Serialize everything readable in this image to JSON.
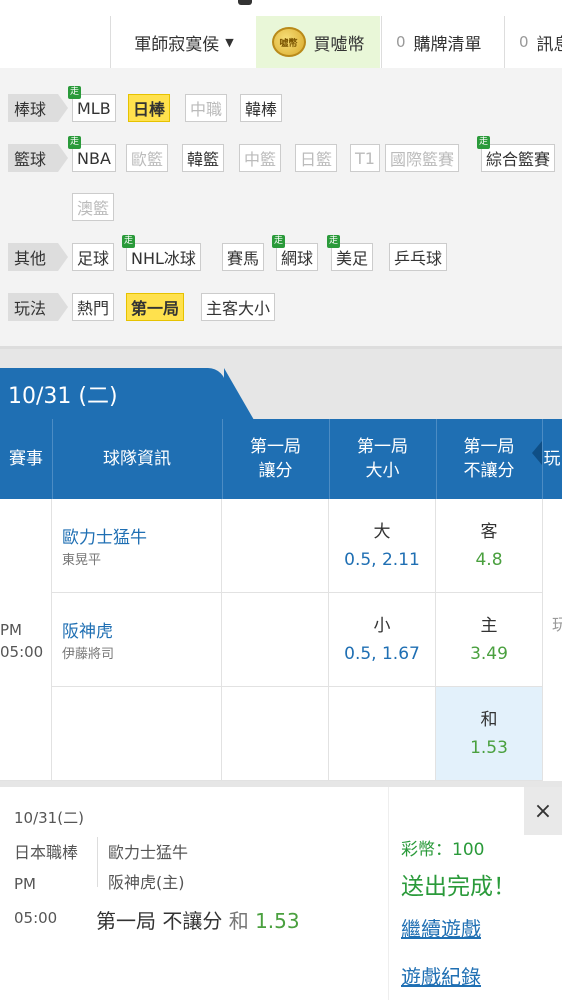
{
  "topnav": {
    "user": "軍師寂寞侯",
    "buy_label": "買噓幣",
    "coin_text": "噓幣",
    "cart_count": "0",
    "cart_label": "購牌清單",
    "msg_count": "0",
    "msg_label": "訊息"
  },
  "filters": {
    "baseball": {
      "label": "棒球",
      "items": [
        "MLB",
        "日棒",
        "中職",
        "韓棒"
      ]
    },
    "basketball": {
      "label": "籃球",
      "items": [
        "NBA",
        "歐籃",
        "韓籃",
        "中籃",
        "日籃",
        "T1",
        "國際籃賽",
        "綜合籃賽",
        "澳籃"
      ]
    },
    "other": {
      "label": "其他",
      "items": [
        "足球",
        "NHL冰球",
        "賽馬",
        "網球",
        "美足",
        "乒乓球"
      ]
    },
    "mode": {
      "label": "玩法",
      "items": [
        "熱門",
        "第一局",
        "主客大小"
      ]
    },
    "go_badge": "走"
  },
  "date_tab": "10/31 (二)",
  "table": {
    "headers": {
      "event": "賽事",
      "team": "球隊資訊",
      "spread": [
        "第一局",
        "讓分"
      ],
      "total": [
        "第一局",
        "大小"
      ],
      "moneyline": [
        "第一局",
        "不讓分"
      ],
      "more": "玩"
    },
    "time": [
      "PM",
      "05:00"
    ],
    "rows": [
      {
        "team": "歐力士猛牛",
        "pitcher": "東晃平",
        "total_label": "大",
        "total_value": "0.5, 2.11",
        "ml_label": "客",
        "ml_value": "4.8"
      },
      {
        "team": "阪神虎",
        "pitcher": "伊藤將司",
        "total_label": "小",
        "total_value": "0.5, 1.67",
        "ml_label": "主",
        "ml_value": "3.49"
      },
      {
        "team": "",
        "pitcher": "",
        "total_label": "",
        "total_value": "",
        "ml_label": "和",
        "ml_value": "1.53"
      }
    ],
    "side_glyph": "玩"
  },
  "popup": {
    "date": "10/31(二)",
    "league": "日本職棒",
    "team_away": "歐力士猛牛",
    "team_home": "阪神虎(主)",
    "time_ampm": "PM",
    "time": "05:00",
    "bet_type": "第一局 不讓分",
    "bet_pick": "和",
    "bet_odds": "1.53",
    "coin_label": "彩幣：100",
    "done_label": "送出完成！",
    "continue_link": "繼續遊戲",
    "record_link": "遊戲紀錄",
    "close": "×"
  },
  "colors": {
    "primary": "#1f6fb3",
    "green": "#2a9a3a",
    "yellow": "#ffe14d",
    "odds_green": "#4aa03f"
  }
}
